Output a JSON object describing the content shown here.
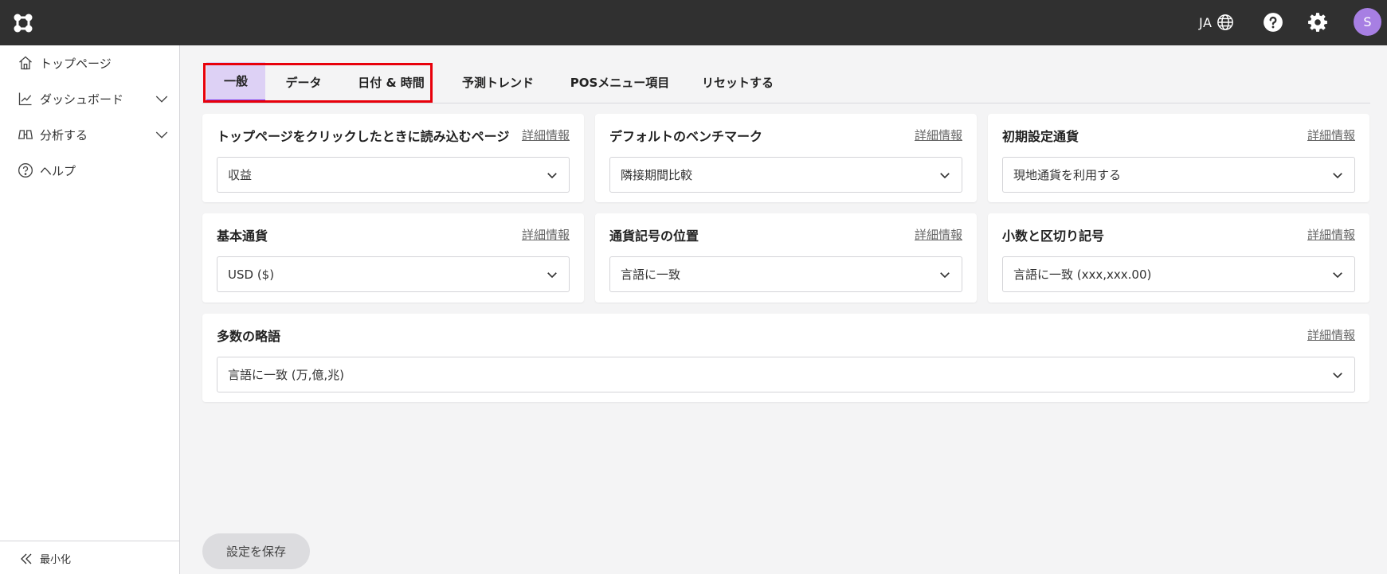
{
  "header": {
    "lang_code": "JA",
    "avatar_initial": "S",
    "icons": [
      "app-logo-icon",
      "globe-icon",
      "help-icon",
      "gear-icon"
    ]
  },
  "sidebar": {
    "items": [
      {
        "label": "トップページ",
        "icon": "home-icon"
      },
      {
        "label": "ダッシュボード",
        "icon": "chart-line-icon"
      },
      {
        "label": "分析する",
        "icon": "binoculars-icon"
      },
      {
        "label": "ヘルプ",
        "icon": "help-circle-icon"
      }
    ],
    "minimize_label": "最小化"
  },
  "tabs": [
    "一般",
    "データ",
    "日付 & 時間",
    "予測トレンド",
    "POSメニュー項目",
    "リセットする"
  ],
  "active_tab": "一般",
  "detail_link": "詳細情報",
  "settings": [
    {
      "title": "トップページをクリックしたときに読み込むページ",
      "value": "収益"
    },
    {
      "title": "デフォルトのベンチマーク",
      "value": "隣接期間比較"
    },
    {
      "title": "初期設定通貨",
      "value": "現地通貨を利用する"
    },
    {
      "title": "基本通貨",
      "value": "USD ($)"
    },
    {
      "title": "通貨記号の位置",
      "value": "言語に一致"
    },
    {
      "title": "小数と区切り記号",
      "value": "言語に一致 (xxx,xxx.00)"
    },
    {
      "title": "多数の略語",
      "value": "言語に一致 (万,億,兆)"
    }
  ],
  "save_label": "設定を保存",
  "colors": {
    "topbar": "#303030",
    "accent": "#7c3aed",
    "tab_active_bg": "#ddd1f5",
    "highlight": "#e8000b",
    "avatar": "#a77fe3"
  }
}
